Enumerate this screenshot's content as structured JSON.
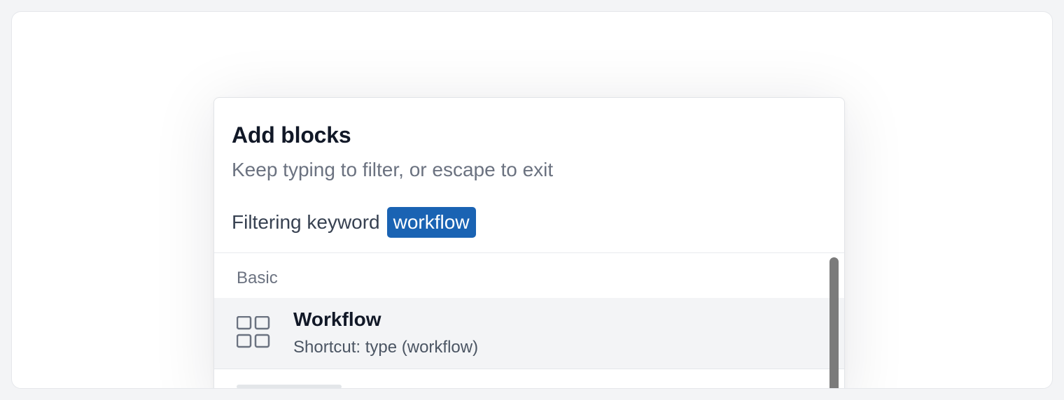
{
  "panel": {
    "title": "Add blocks",
    "subtitle": "Keep typing to filter, or escape to exit",
    "filter_label": "Filtering keyword",
    "filter_keyword": "workflow"
  },
  "results": {
    "section_label": "Basic",
    "items": [
      {
        "title": "Workflow",
        "subtitle": "Shortcut: type (workflow)",
        "icon": "grid-icon"
      }
    ]
  },
  "colors": {
    "accent": "#1a63b3",
    "highlight_row": "#f3f4f6",
    "title_text": "#111827",
    "muted_text": "#6b7280",
    "scrollbar": "#7b7b7b"
  }
}
